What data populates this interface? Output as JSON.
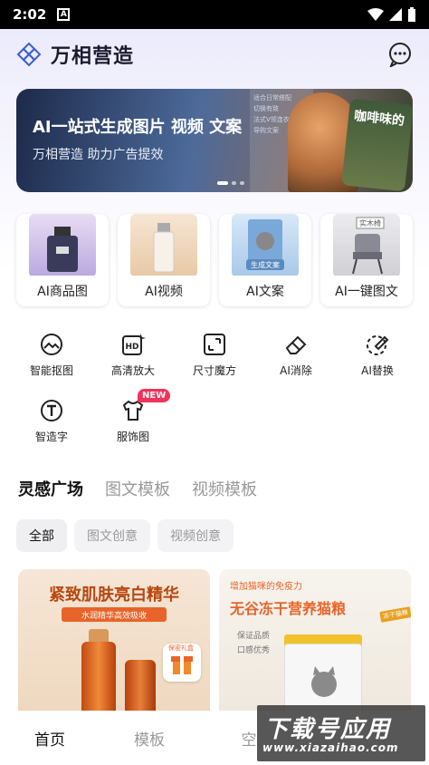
{
  "status_bar": {
    "time": "2:02",
    "notification_icon": "A"
  },
  "header": {
    "app_name": "万相营造",
    "logo_icon": "logo-icon",
    "chat_icon": "chat-bubble-icon"
  },
  "banner": {
    "title": "AI一站式生成图片 视频 文案",
    "subtitle": "万相营造 助力广告提效",
    "card_text": "咖啡味的",
    "text_card_lines": "适合日常搭配\n切换有致\n法式V领连衣裙\n导购文案",
    "page_count": 3,
    "active_page": 1
  },
  "features": [
    {
      "label": "AI商品图",
      "thumb_color": "#cfc4e8"
    },
    {
      "label": "AI视频",
      "thumb_color": "#f1dcc4"
    },
    {
      "label": "AI文案",
      "thumb_color": "#c8dcf0",
      "thumb_text": "生成文案"
    },
    {
      "label": "AI一键图文",
      "thumb_color": "#d8d8dc",
      "thumb_text": "实木椅"
    }
  ],
  "tools": [
    {
      "label": "智能抠图",
      "icon": "smart-cutout-icon"
    },
    {
      "label": "高清放大",
      "icon": "hd-upscale-icon"
    },
    {
      "label": "尺寸魔方",
      "icon": "resize-icon"
    },
    {
      "label": "AI消除",
      "icon": "eraser-icon"
    },
    {
      "label": "AI替换",
      "icon": "replace-icon"
    },
    {
      "label": "智造字",
      "icon": "text-icon"
    },
    {
      "label": "服饰图",
      "icon": "tshirt-icon",
      "badge": "NEW"
    }
  ],
  "tabs": [
    {
      "label": "灵感广场",
      "active": true
    },
    {
      "label": "图文模板",
      "active": false
    },
    {
      "label": "视频模板",
      "active": false
    }
  ],
  "chips": [
    {
      "label": "全部",
      "active": true
    },
    {
      "label": "图文创意",
      "active": false
    },
    {
      "label": "视频创意",
      "active": false
    }
  ],
  "cards": {
    "left": {
      "title": "紧致肌肤亮白精华",
      "subtitle": "水润精华高效吸收",
      "gift": "保密礼盒"
    },
    "right": {
      "top": "增加猫咪的免疫力",
      "title": "无谷冻干营养猫粮",
      "tag": "冻干猫粮",
      "feature1": "保证品质",
      "feature2": "口感优秀"
    }
  },
  "bottom_nav": [
    {
      "label": "首页",
      "active": true
    },
    {
      "label": "模板",
      "active": false
    },
    {
      "label": "空",
      "active": false
    }
  ],
  "watermark": {
    "main": "下载号应用",
    "url": "www.xiazaihao.com"
  }
}
